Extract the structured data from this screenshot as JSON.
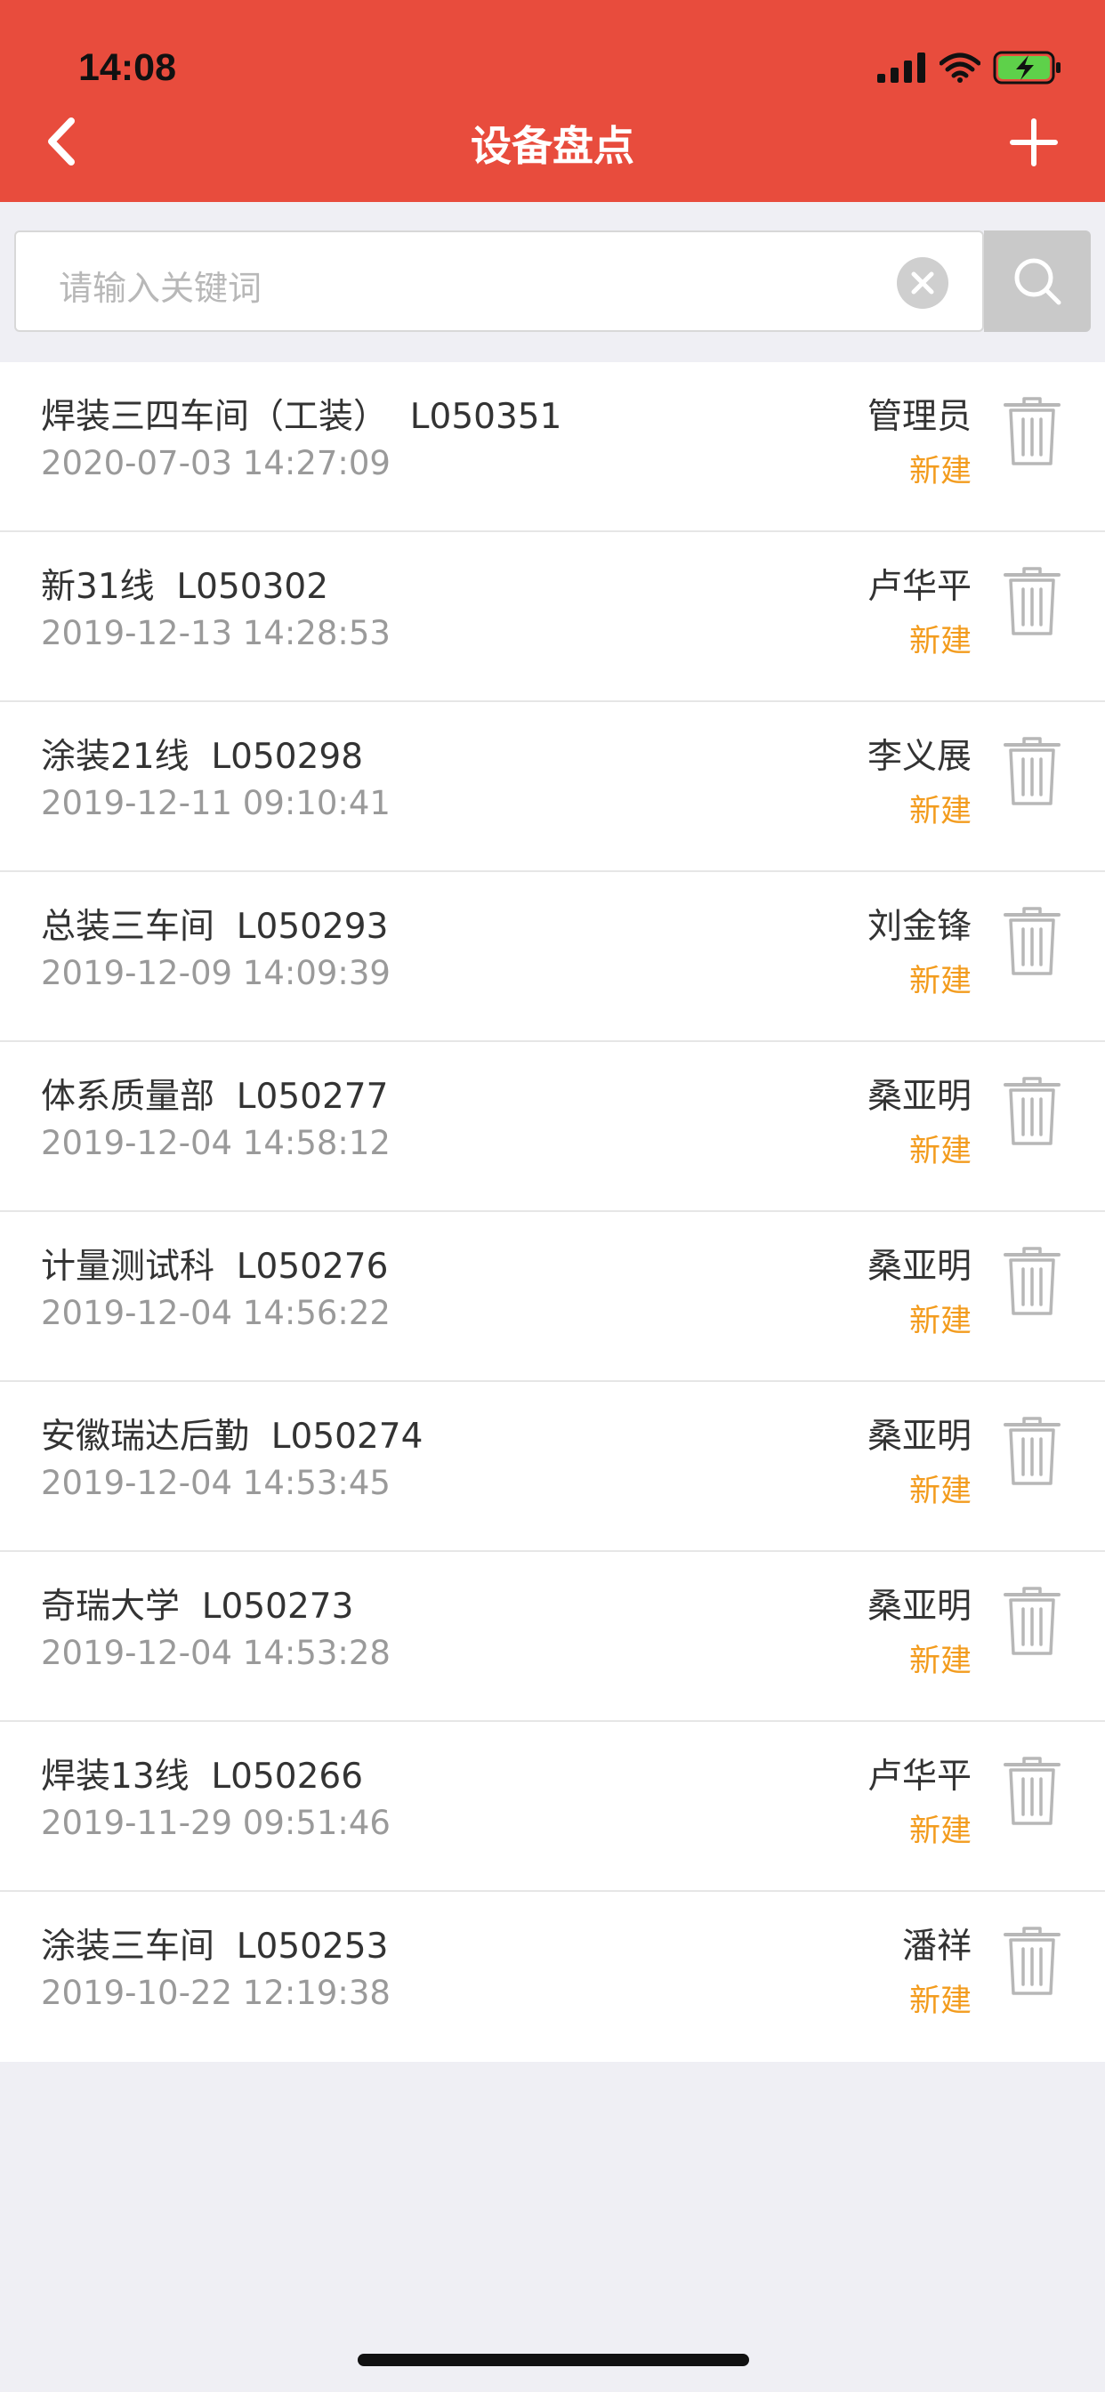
{
  "status_bar": {
    "time": "14:08"
  },
  "nav": {
    "title": "设备盘点"
  },
  "search": {
    "placeholder": "请输入关键词"
  },
  "records": [
    {
      "title": "焊装三四车间（工装）  L050351",
      "time": "2020-07-03 14:27:09",
      "user": "管理员",
      "status": "新建"
    },
    {
      "title": "新31线  L050302",
      "time": "2019-12-13 14:28:53",
      "user": "卢华平",
      "status": "新建"
    },
    {
      "title": "涂装21线  L050298",
      "time": "2019-12-11 09:10:41",
      "user": "李义展",
      "status": "新建"
    },
    {
      "title": "总装三车间  L050293",
      "time": "2019-12-09 14:09:39",
      "user": "刘金锋",
      "status": "新建"
    },
    {
      "title": "体系质量部  L050277",
      "time": "2019-12-04 14:58:12",
      "user": "桑亚明",
      "status": "新建"
    },
    {
      "title": "计量测试科  L050276",
      "time": "2019-12-04 14:56:22",
      "user": "桑亚明",
      "status": "新建"
    },
    {
      "title": "安徽瑞达后勤  L050274",
      "time": "2019-12-04 14:53:45",
      "user": "桑亚明",
      "status": "新建"
    },
    {
      "title": "奇瑞大学  L050273",
      "time": "2019-12-04 14:53:28",
      "user": "桑亚明",
      "status": "新建"
    },
    {
      "title": "焊装13线  L050266",
      "time": "2019-11-29 09:51:46",
      "user": "卢华平",
      "status": "新建"
    },
    {
      "title": "涂装三车间  L050253",
      "time": "2019-10-22 12:19:38",
      "user": "潘祥",
      "status": "新建"
    }
  ],
  "colors": {
    "header": "#e84c3d",
    "status": "#f39c1e",
    "background": "#efeff4"
  },
  "icons": {
    "back": "chevron-left-icon",
    "add": "plus-icon",
    "clear": "clear-circle-icon",
    "search": "search-icon",
    "delete": "trash-icon"
  }
}
